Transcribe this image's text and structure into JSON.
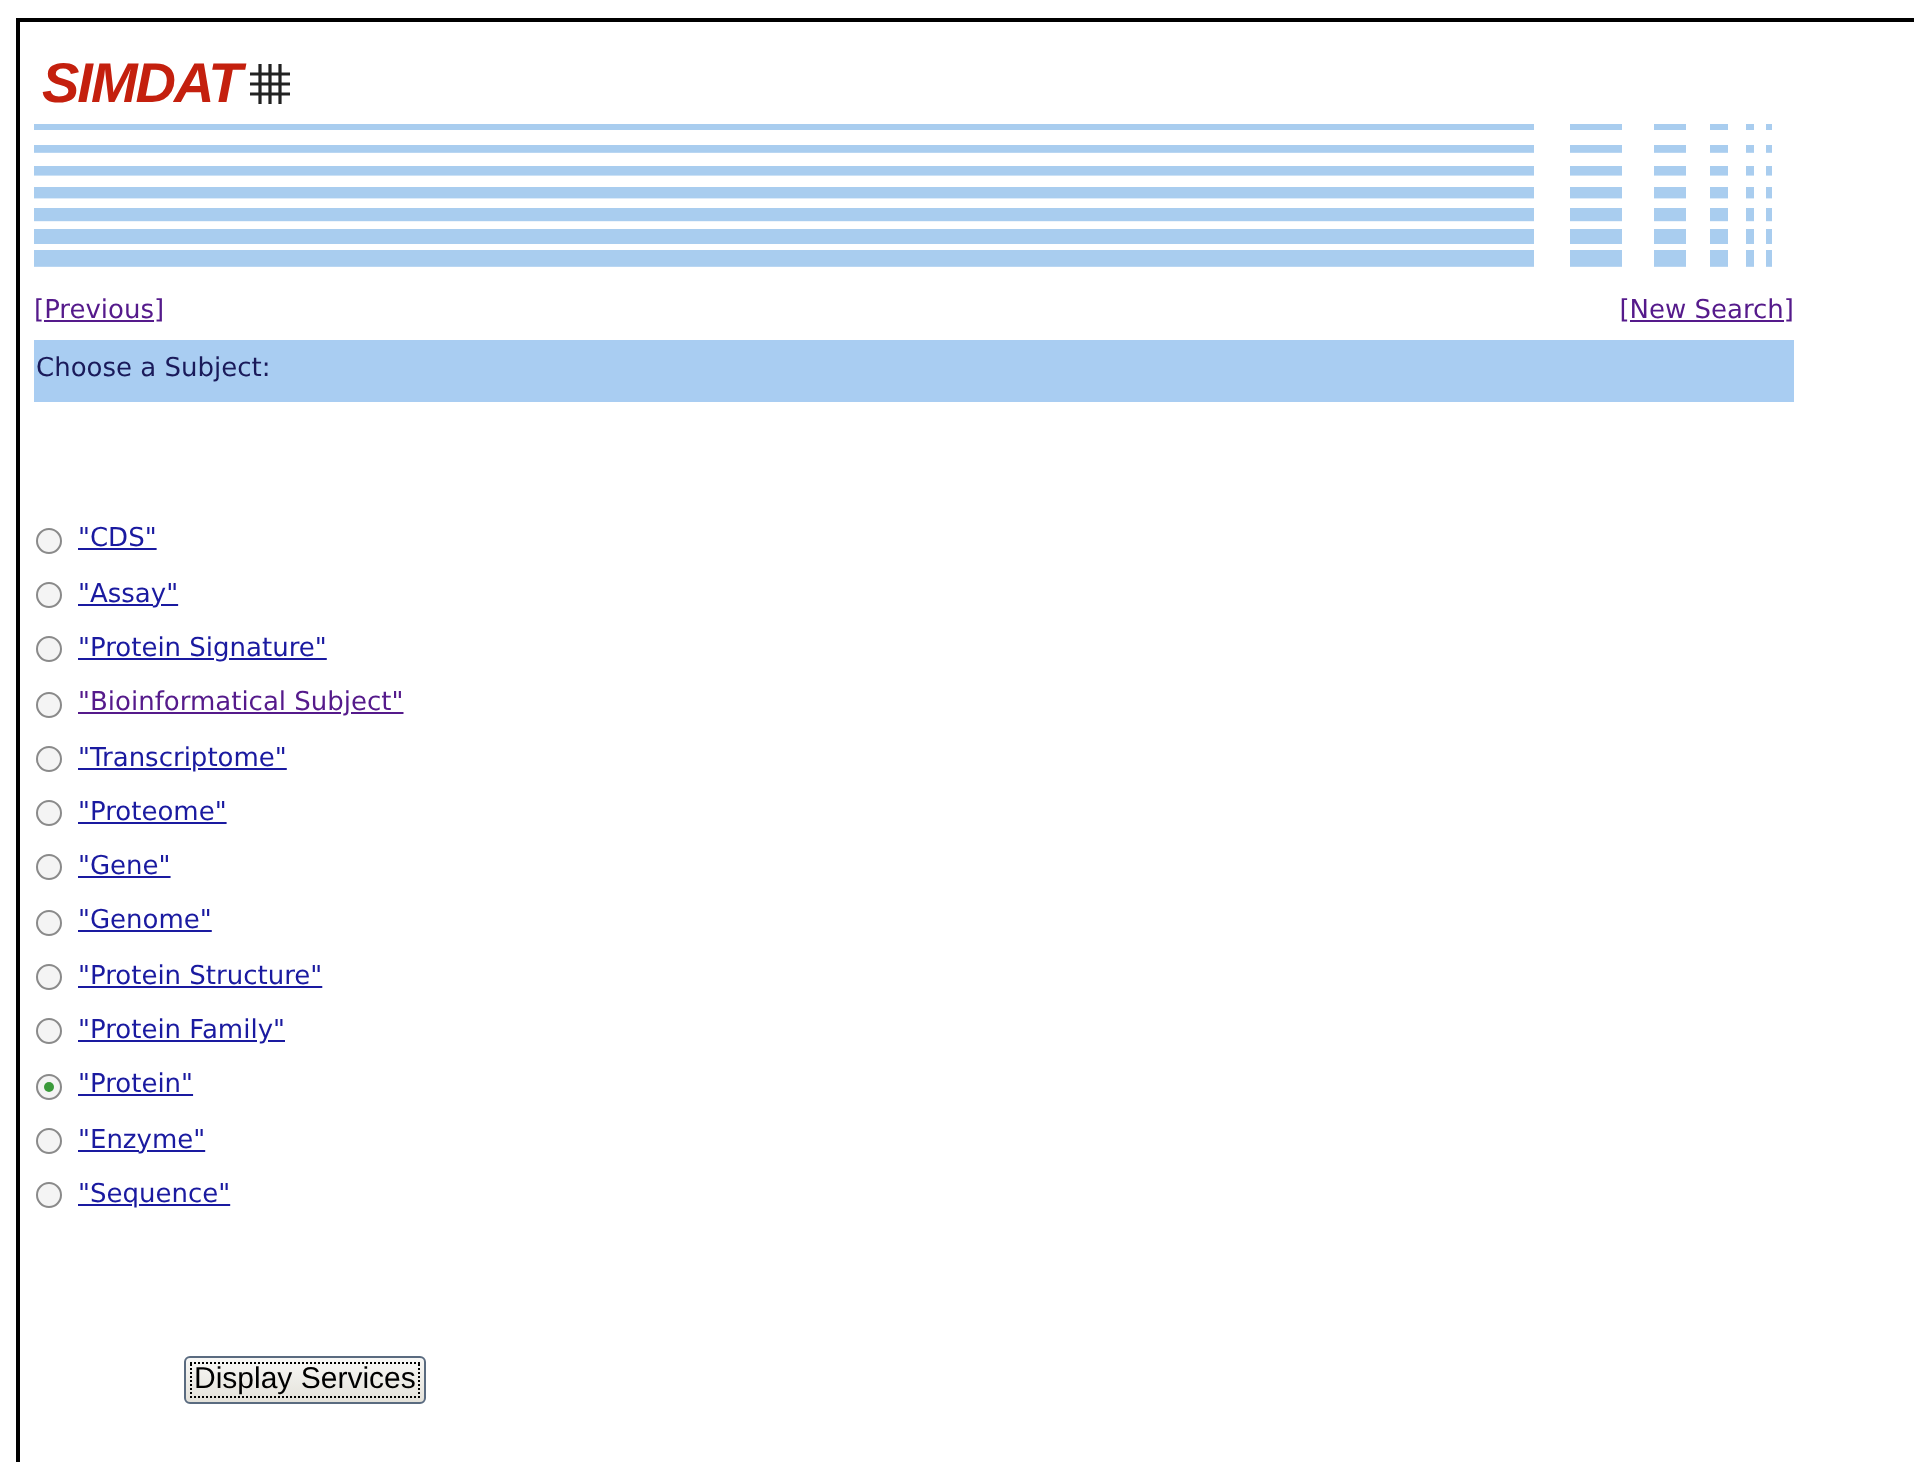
{
  "logo": {
    "text": "SIMDAT"
  },
  "nav": {
    "previous": "[Previous]",
    "new_search": "[New Search]"
  },
  "heading": "Choose a Subject:",
  "subjects": [
    {
      "label": "\"CDS\"",
      "selected": false,
      "visited": false
    },
    {
      "label": "\"Assay\"",
      "selected": false,
      "visited": false
    },
    {
      "label": "\"Protein Signature\"",
      "selected": false,
      "visited": false
    },
    {
      "label": "\"Bioinformatical Subject\"",
      "selected": false,
      "visited": true
    },
    {
      "label": "\"Transcriptome\"",
      "selected": false,
      "visited": false
    },
    {
      "label": "\"Proteome\"",
      "selected": false,
      "visited": false
    },
    {
      "label": "\"Gene\"",
      "selected": false,
      "visited": false
    },
    {
      "label": "\"Genome\"",
      "selected": false,
      "visited": false
    },
    {
      "label": "\"Protein Structure\"",
      "selected": false,
      "visited": false
    },
    {
      "label": "\"Protein Family\"",
      "selected": false,
      "visited": false
    },
    {
      "label": "\"Protein\"",
      "selected": true,
      "visited": false
    },
    {
      "label": "\"Enzyme\"",
      "selected": false,
      "visited": false
    },
    {
      "label": "\"Sequence\"",
      "selected": false,
      "visited": false
    }
  ],
  "button": "Display Services"
}
